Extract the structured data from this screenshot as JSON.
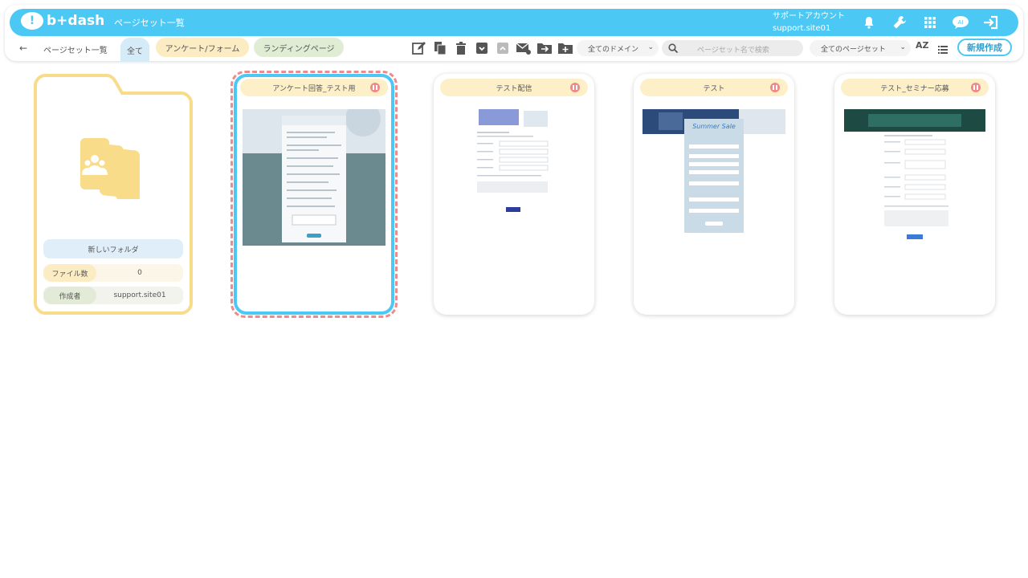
{
  "header": {
    "logo_text": "b+dash",
    "title": "ページセット一覧",
    "account_line1": "サポートアカウント",
    "account_line2": "support.site01",
    "icons": [
      "bell-icon",
      "wrench-icon",
      "apps-grid-icon",
      "ai-chat-icon",
      "logout-icon"
    ],
    "accent": "#4cc8f4"
  },
  "toolbar": {
    "back_label": "←",
    "breadcrumb": "ページセット一覧",
    "tabs": [
      {
        "label": "全て",
        "active": true
      },
      {
        "label": "アンケート/フォーム",
        "active": false
      },
      {
        "label": "ランディングページ",
        "active": false
      }
    ],
    "tool_icons": [
      "edit-icon",
      "copy-icon",
      "trash-icon",
      "archive-icon",
      "unarchive-icon",
      "mail-icon",
      "move-to-folder-icon",
      "new-folder-icon"
    ],
    "domain_select": "全てのドメイン",
    "search_placeholder": "ページセット名で検索",
    "pageset_select": "全てのページセット",
    "sort_label": "AZ",
    "new_button": "新規作成"
  },
  "folder": {
    "name": "新しいフォルダ",
    "files_label": "ファイル数",
    "files_value": "0",
    "author_label": "作成者",
    "author_value": "support.site01",
    "color": "#f8dc8a"
  },
  "cards": [
    {
      "title": "アンケート回答_テスト用",
      "selected": true
    },
    {
      "title": "テスト配信",
      "selected": false
    },
    {
      "title": "テスト",
      "selected": false
    },
    {
      "title": "テスト_セミナー応募",
      "selected": false
    }
  ]
}
